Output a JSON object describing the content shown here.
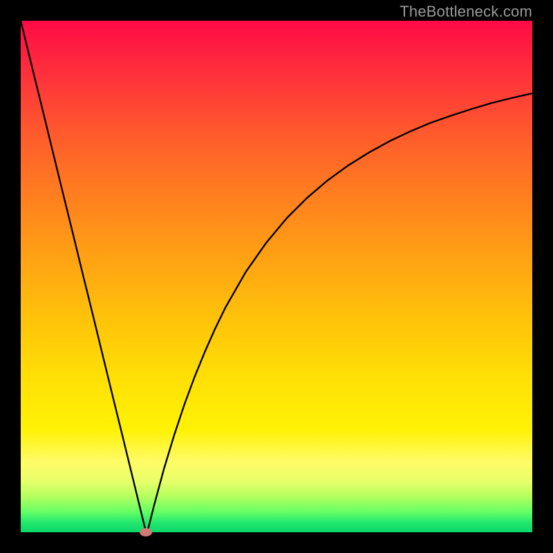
{
  "watermark": "TheBottleneck.com",
  "chart_data": {
    "type": "line",
    "title": "",
    "xlabel": "",
    "ylabel": "",
    "xlim": [
      0,
      100
    ],
    "ylim": [
      0,
      100
    ],
    "grid": false,
    "legend": false,
    "x": [
      0,
      2,
      4,
      6,
      8,
      10,
      12,
      14,
      16,
      18,
      20,
      22,
      24,
      24.5,
      25,
      26,
      28,
      30,
      32,
      34,
      36,
      38,
      40,
      44,
      48,
      52,
      56,
      60,
      64,
      68,
      72,
      76,
      80,
      84,
      88,
      92,
      96,
      100
    ],
    "y": [
      100,
      91.8,
      83.7,
      75.5,
      67.3,
      59.2,
      51.0,
      42.9,
      34.7,
      26.5,
      18.4,
      10.2,
      2.0,
      0,
      1.0,
      5.0,
      12.4,
      19.0,
      25.0,
      30.4,
      35.3,
      39.8,
      43.9,
      50.9,
      56.6,
      61.4,
      65.4,
      68.8,
      71.7,
      74.2,
      76.4,
      78.3,
      80.0,
      81.4,
      82.7,
      83.9,
      84.9,
      85.8
    ],
    "marker": {
      "x": 24.5,
      "y": 0
    },
    "background_gradient": {
      "top_color": "#ff0a46",
      "bottom_color": "#08d86a",
      "stops": [
        "red",
        "orange",
        "yellow",
        "green"
      ]
    },
    "line_color": "#000000",
    "marker_color": "#cf7a74"
  }
}
